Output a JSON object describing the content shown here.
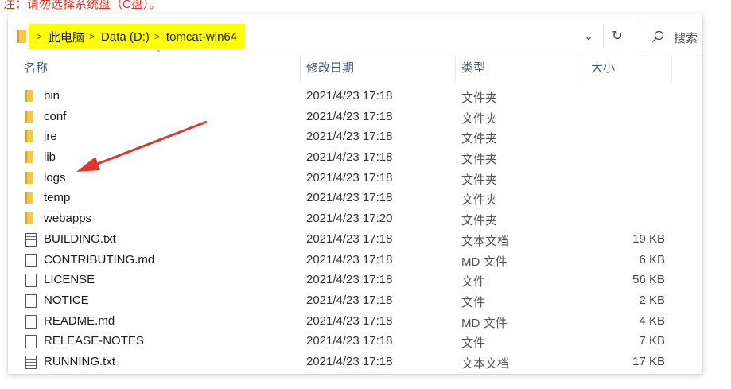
{
  "note": "注：请勿选择系统盘（C盘）。",
  "address_bar": {
    "crumbs": [
      "此电脑",
      "Data (D:)",
      "tomcat-win64"
    ],
    "separator": ">",
    "dropdown_icon": "chevron-down-icon",
    "refresh_icon": "refresh-icon",
    "highlight_color": "#ffff00"
  },
  "search": {
    "placeholder": "搜索"
  },
  "columns": {
    "name": "名称",
    "date": "修改日期",
    "type": "类型",
    "size": "大小"
  },
  "files": [
    {
      "name": "bin",
      "date": "2021/4/23 17:18",
      "type": "文件夹",
      "size": "",
      "icon": "folder-icon"
    },
    {
      "name": "conf",
      "date": "2021/4/23 17:18",
      "type": "文件夹",
      "size": "",
      "icon": "folder-icon"
    },
    {
      "name": "jre",
      "date": "2021/4/23 17:18",
      "type": "文件夹",
      "size": "",
      "icon": "folder-icon"
    },
    {
      "name": "lib",
      "date": "2021/4/23 17:18",
      "type": "文件夹",
      "size": "",
      "icon": "folder-icon"
    },
    {
      "name": "logs",
      "date": "2021/4/23 17:18",
      "type": "文件夹",
      "size": "",
      "icon": "folder-icon"
    },
    {
      "name": "temp",
      "date": "2021/4/23 17:18",
      "type": "文件夹",
      "size": "",
      "icon": "folder-icon"
    },
    {
      "name": "webapps",
      "date": "2021/4/23 17:20",
      "type": "文件夹",
      "size": "",
      "icon": "folder-icon"
    },
    {
      "name": "BUILDING.txt",
      "date": "2021/4/23 17:18",
      "type": "文本文档",
      "size": "19 KB",
      "icon": "text-file-icon"
    },
    {
      "name": "CONTRIBUTING.md",
      "date": "2021/4/23 17:18",
      "type": "MD 文件",
      "size": "6 KB",
      "icon": "file-icon"
    },
    {
      "name": "LICENSE",
      "date": "2021/4/23 17:18",
      "type": "文件",
      "size": "56 KB",
      "icon": "file-icon"
    },
    {
      "name": "NOTICE",
      "date": "2021/4/23 17:18",
      "type": "文件",
      "size": "2 KB",
      "icon": "file-icon"
    },
    {
      "name": "README.md",
      "date": "2021/4/23 17:18",
      "type": "MD 文件",
      "size": "4 KB",
      "icon": "file-icon"
    },
    {
      "name": "RELEASE-NOTES",
      "date": "2021/4/23 17:18",
      "type": "文件",
      "size": "7 KB",
      "icon": "file-icon"
    },
    {
      "name": "RUNNING.txt",
      "date": "2021/4/23 17:18",
      "type": "文本文档",
      "size": "17 KB",
      "icon": "text-file-icon"
    }
  ],
  "annotation": {
    "icon": "red-arrow-icon",
    "color": "#e0352b"
  }
}
